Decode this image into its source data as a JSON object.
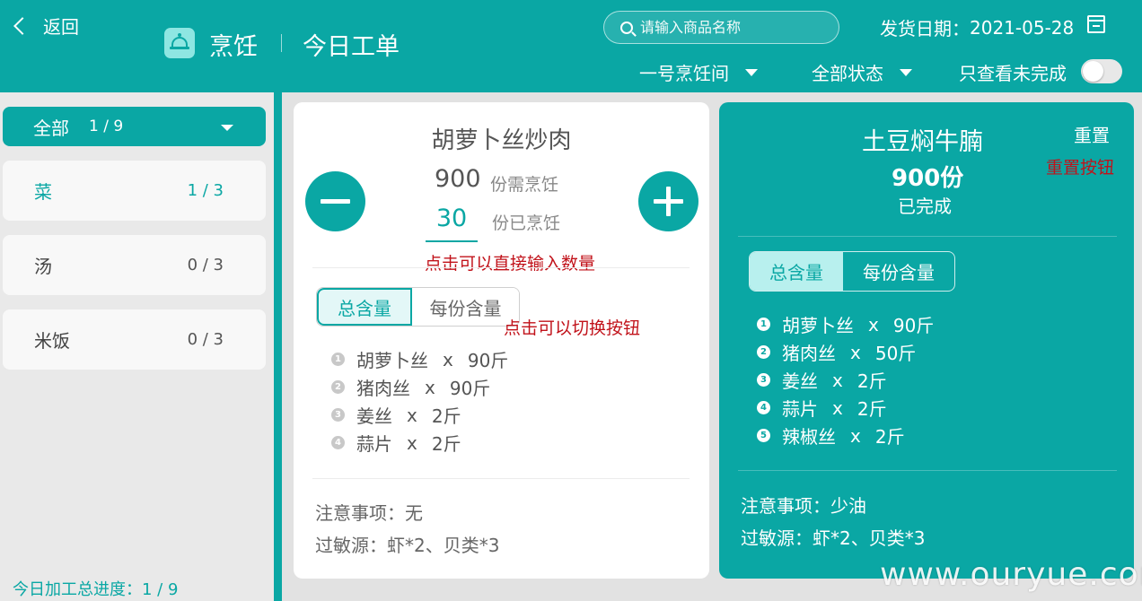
{
  "header": {
    "back_label": "返回",
    "app_name": "烹饪",
    "page_title": "今日工单",
    "search_placeholder": "请输入商品名称",
    "date_label": "发货日期：",
    "date_value": "2021-05-28",
    "station_dropdown": "一号烹饪间",
    "status_dropdown": "全部状态",
    "toggle_label": "只查看未完成",
    "toggle_on": false
  },
  "sidebar": {
    "all": {
      "label": "全部",
      "count": "1 / 9"
    },
    "items": [
      {
        "label": "菜",
        "count": "1 / 3",
        "active": true
      },
      {
        "label": "汤",
        "count": "0 / 3",
        "active": false
      },
      {
        "label": "米饭",
        "count": "0 / 3",
        "active": false
      }
    ],
    "progress_label": "今日加工总进度：1 / 9"
  },
  "card1": {
    "title": "胡萝卜丝炒肉",
    "need_qty": "900",
    "need_label": "份需烹饪",
    "done_qty": "30",
    "done_label": "份已烹饪",
    "annotation_input": "点击可以直接输入数量",
    "tab_total": "总含量",
    "tab_per": "每份含量",
    "annotation_tab": "点击可以切换按钮",
    "ingredients": [
      {
        "num": "1",
        "name": "胡萝卜丝",
        "x": "x",
        "amount": "90斤"
      },
      {
        "num": "2",
        "name": "猪肉丝",
        "x": "x",
        "amount": "90斤"
      },
      {
        "num": "3",
        "name": "姜丝",
        "x": "x",
        "amount": "2斤"
      },
      {
        "num": "4",
        "name": "蒜片",
        "x": "x",
        "amount": "2斤"
      }
    ],
    "notes": "注意事项：无",
    "allergens": "过敏源：虾*2、贝类*3"
  },
  "card2": {
    "title": "土豆焖牛腩",
    "qty": "900份",
    "status": "已完成",
    "reset_label": "重置",
    "annotation_reset": "重置按钮",
    "tab_total": "总含量",
    "tab_per": "每份含量",
    "ingredients": [
      {
        "num": "1",
        "name": "胡萝卜丝",
        "x": "x",
        "amount": "90斤"
      },
      {
        "num": "2",
        "name": "猪肉丝",
        "x": "x",
        "amount": "50斤"
      },
      {
        "num": "3",
        "name": "姜丝",
        "x": "x",
        "amount": "2斤"
      },
      {
        "num": "4",
        "name": "蒜片",
        "x": "x",
        "amount": "2斤"
      },
      {
        "num": "5",
        "name": "辣椒丝",
        "x": "x",
        "amount": "2斤"
      }
    ],
    "notes": "注意事项：少油",
    "allergens": "过敏源：虾*2、贝类*3"
  },
  "watermark": "www.ouryue.com",
  "colors": {
    "accent": "#0aa7a4",
    "annotation": "#c1121a",
    "sidebar_bg": "#e9e9e9"
  }
}
